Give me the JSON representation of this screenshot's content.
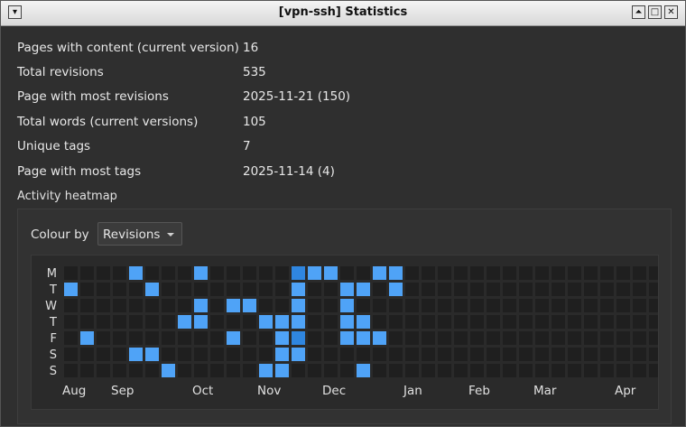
{
  "window": {
    "title": "[vpn-ssh] Statistics",
    "menu_icon": "menu-down-icon",
    "controls": [
      "maximize-up-icon",
      "maximize-icon",
      "close-icon"
    ]
  },
  "stats": [
    {
      "label": "Pages with content (current version)",
      "value": "16"
    },
    {
      "label": "Total revisions",
      "value": "535"
    },
    {
      "label": "Page with most revisions",
      "value": "2025-11-21 (150)"
    },
    {
      "label": "Total words (current versions)",
      "value": "105"
    },
    {
      "label": "Unique tags",
      "value": "7"
    },
    {
      "label": "Page with most tags",
      "value": "2025-11-14 (4)"
    }
  ],
  "heatmap": {
    "section_label": "Activity heatmap",
    "colour_by_label": "Colour by",
    "colour_by_value": "Revisions"
  },
  "colors": {
    "empty": "#1f1f1f",
    "low": "#4fa3f7",
    "high": "#2f86e0"
  },
  "chart_data": {
    "type": "heatmap",
    "day_labels": [
      "M",
      "T",
      "W",
      "T",
      "F",
      "S",
      "S"
    ],
    "month_labels": [
      {
        "label": "Aug",
        "week": 0
      },
      {
        "label": "Sep",
        "week": 3
      },
      {
        "label": "Oct",
        "week": 8
      },
      {
        "label": "Nov",
        "week": 12
      },
      {
        "label": "Dec",
        "week": 16
      },
      {
        "label": "Jan",
        "week": 21
      },
      {
        "label": "Feb",
        "week": 25
      },
      {
        "label": "Mar",
        "week": 29
      },
      {
        "label": "Apr",
        "week": 34
      }
    ],
    "weeks": 37,
    "active_cells": [
      {
        "week": 4,
        "day": 0,
        "level": 1
      },
      {
        "week": 8,
        "day": 0,
        "level": 1
      },
      {
        "week": 14,
        "day": 0,
        "level": 2
      },
      {
        "week": 15,
        "day": 0,
        "level": 1
      },
      {
        "week": 16,
        "day": 0,
        "level": 1
      },
      {
        "week": 19,
        "day": 0,
        "level": 1
      },
      {
        "week": 20,
        "day": 0,
        "level": 1
      },
      {
        "week": 0,
        "day": 1,
        "level": 1
      },
      {
        "week": 5,
        "day": 1,
        "level": 1
      },
      {
        "week": 14,
        "day": 1,
        "level": 1
      },
      {
        "week": 17,
        "day": 1,
        "level": 1
      },
      {
        "week": 18,
        "day": 1,
        "level": 1
      },
      {
        "week": 20,
        "day": 1,
        "level": 1
      },
      {
        "week": 8,
        "day": 2,
        "level": 1
      },
      {
        "week": 10,
        "day": 2,
        "level": 1
      },
      {
        "week": 11,
        "day": 2,
        "level": 1
      },
      {
        "week": 14,
        "day": 2,
        "level": 1
      },
      {
        "week": 17,
        "day": 2,
        "level": 1
      },
      {
        "week": 7,
        "day": 3,
        "level": 1
      },
      {
        "week": 8,
        "day": 3,
        "level": 1
      },
      {
        "week": 12,
        "day": 3,
        "level": 1
      },
      {
        "week": 13,
        "day": 3,
        "level": 1
      },
      {
        "week": 14,
        "day": 3,
        "level": 1
      },
      {
        "week": 17,
        "day": 3,
        "level": 1
      },
      {
        "week": 18,
        "day": 3,
        "level": 1
      },
      {
        "week": 1,
        "day": 4,
        "level": 1
      },
      {
        "week": 10,
        "day": 4,
        "level": 1
      },
      {
        "week": 13,
        "day": 4,
        "level": 1
      },
      {
        "week": 14,
        "day": 4,
        "level": 2
      },
      {
        "week": 17,
        "day": 4,
        "level": 1
      },
      {
        "week": 18,
        "day": 4,
        "level": 1
      },
      {
        "week": 19,
        "day": 4,
        "level": 1
      },
      {
        "week": 4,
        "day": 5,
        "level": 1
      },
      {
        "week": 5,
        "day": 5,
        "level": 1
      },
      {
        "week": 13,
        "day": 5,
        "level": 1
      },
      {
        "week": 14,
        "day": 5,
        "level": 1
      },
      {
        "week": 6,
        "day": 6,
        "level": 1
      },
      {
        "week": 12,
        "day": 6,
        "level": 1
      },
      {
        "week": 13,
        "day": 6,
        "level": 1
      },
      {
        "week": 18,
        "day": 6,
        "level": 1
      }
    ]
  }
}
